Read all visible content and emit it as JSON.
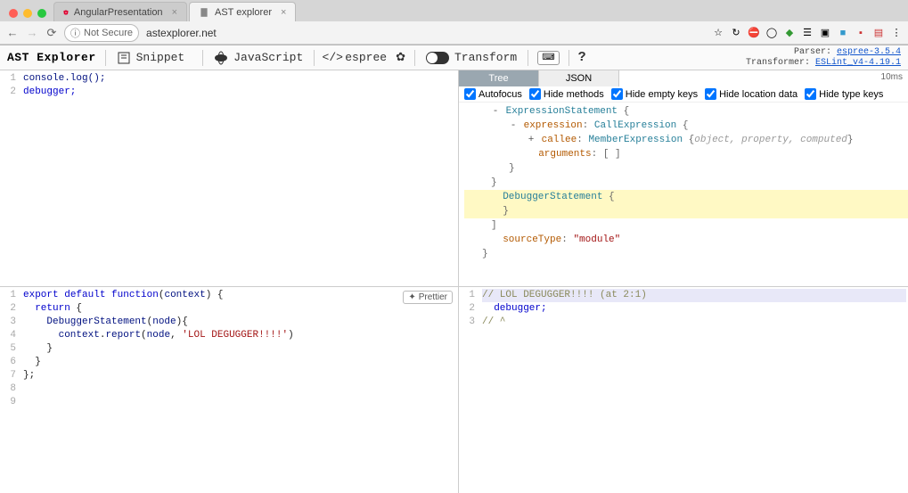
{
  "browser": {
    "tabs": [
      {
        "title": "AngularPresentation",
        "active": false,
        "favicon_color": "#dd0031"
      },
      {
        "title": "AST explorer",
        "active": true,
        "favicon_color": "#555"
      }
    ],
    "not_secure_label": "Not Secure",
    "url": "astexplorer.net",
    "ext_icons": [
      "★",
      "↻",
      "⛔",
      "◯",
      "◆",
      "☰",
      "▣",
      "■",
      "▪",
      "▤",
      "⋮"
    ]
  },
  "toolbar": {
    "title": "AST Explorer",
    "snippet_label": "Snippet",
    "lang_label": "JavaScript",
    "parser_label": "espree",
    "transform_label": "Transform",
    "help_glyph": "?",
    "parser_info_label": "Parser:",
    "parser_info_value": "espree-3.5.4",
    "transformer_info_label": "Transformer:",
    "transformer_info_value": "ESLint_v4-4.19.1"
  },
  "source_editor": {
    "lines": [
      "console.log();",
      "debugger;"
    ]
  },
  "transform_editor": {
    "prettier_label": "Prettier",
    "lines": [
      "export default function(context) {",
      "  return {",
      "    DebuggerStatement(node){",
      "      context.report(node, 'LOL DEGUGGER!!!!')",
      "    }",
      "  }",
      "};",
      "",
      ""
    ]
  },
  "tree_pane": {
    "tab_tree": "Tree",
    "tab_json": "JSON",
    "time": "10ms",
    "options": [
      "Autofocus",
      "Hide methods",
      "Hide empty keys",
      "Hide location data",
      "Hide type keys"
    ],
    "nodes": {
      "expr_stmt": "ExpressionStatement",
      "expression": "expression",
      "call_expr": "CallExpression",
      "callee": "callee",
      "member_expr": "MemberExpression",
      "member_props": "object, property, computed",
      "arguments": "arguments",
      "arguments_val": "[ ]",
      "debugger_stmt": "DebuggerStatement",
      "source_type_key": "sourceType",
      "source_type_val": "\"module\""
    }
  },
  "output_pane": {
    "lines": [
      "// LOL DEGUGGER!!!! (at 2:1)",
      "  debugger;",
      "// ^"
    ]
  }
}
